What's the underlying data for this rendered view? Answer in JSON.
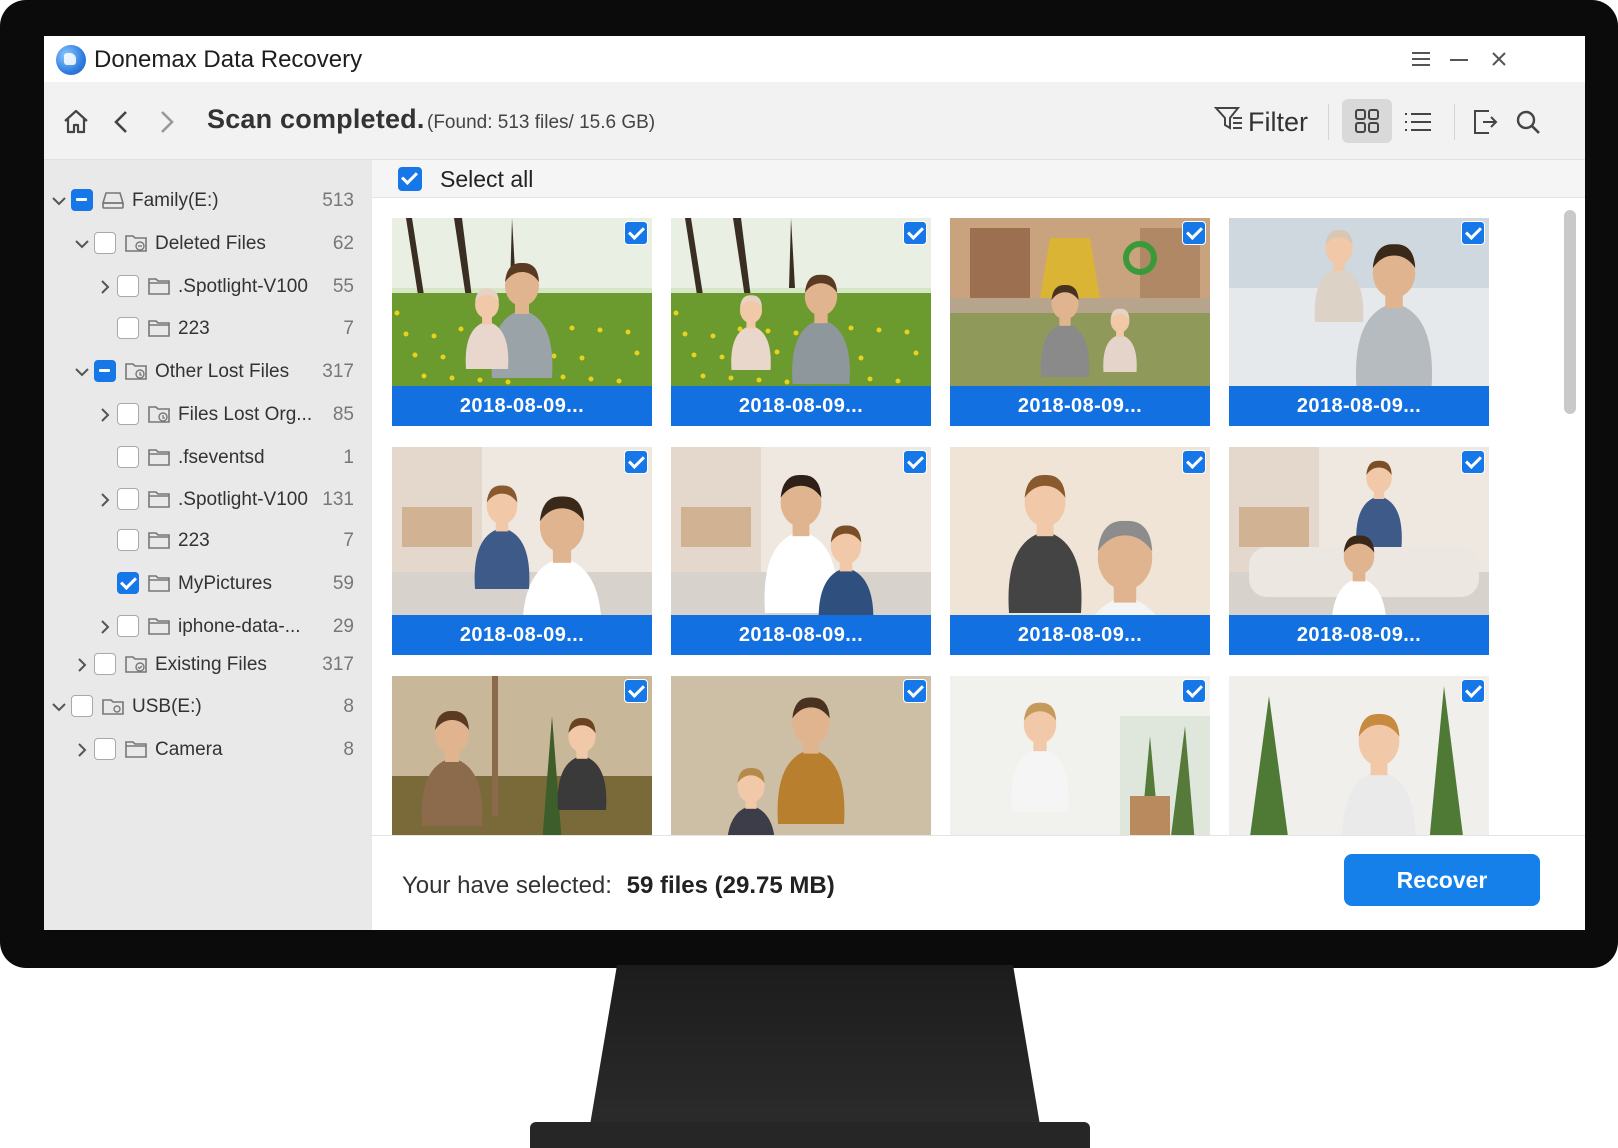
{
  "app": {
    "title": "Donemax Data Recovery"
  },
  "toolbar": {
    "scan_title": "Scan completed.",
    "scan_sub": "(Found: 513 files/ 15.6 GB)",
    "filter_label": "Filter"
  },
  "tree": [
    {
      "label": "Family(E:)",
      "count": "513",
      "level": 0,
      "expand": "open",
      "check": "partial",
      "icon": "drive-icon"
    },
    {
      "label": "Deleted Files",
      "count": "62",
      "level": 1,
      "expand": "open",
      "check": "none",
      "icon": "deleted-folder-icon"
    },
    {
      "label": ".Spotlight-V100",
      "count": "55",
      "level": 2,
      "expand": "closed",
      "check": "none",
      "icon": "folder-icon"
    },
    {
      "label": "223",
      "count": "7",
      "level": 2,
      "expand": "none",
      "check": "none",
      "icon": "folder-icon"
    },
    {
      "label": "Other Lost Files",
      "count": "317",
      "level": 1,
      "expand": "open",
      "check": "partial",
      "icon": "lost-folder-icon"
    },
    {
      "label": "Files Lost Org...",
      "count": "85",
      "level": 2,
      "expand": "closed",
      "check": "none",
      "icon": "lost-folder-icon"
    },
    {
      "label": ".fseventsd",
      "count": "1",
      "level": 2,
      "expand": "none",
      "check": "none",
      "icon": "folder-icon"
    },
    {
      "label": ".Spotlight-V100",
      "count": "131",
      "level": 2,
      "expand": "closed",
      "check": "none",
      "icon": "folder-icon"
    },
    {
      "label": "223",
      "count": "7",
      "level": 2,
      "expand": "none",
      "check": "none",
      "icon": "folder-icon"
    },
    {
      "label": "MyPictures",
      "count": "59",
      "level": 2,
      "expand": "none",
      "check": "checked",
      "icon": "folder-icon"
    },
    {
      "label": "iphone-data-...",
      "count": "29",
      "level": 2,
      "expand": "closed",
      "check": "none",
      "icon": "folder-icon"
    },
    {
      "label": "Existing Files",
      "count": "317",
      "level": 1,
      "expand": "closed",
      "check": "none",
      "icon": "existing-folder-icon"
    },
    {
      "label": "USB(E:)",
      "count": "8",
      "level": 0,
      "expand": "open",
      "check": "none",
      "icon": "usb-drive-icon"
    },
    {
      "label": "Camera",
      "count": "8",
      "level": 1,
      "expand": "closed",
      "check": "none",
      "icon": "folder-icon"
    }
  ],
  "content": {
    "select_all_label": "Select all",
    "select_all_checked": true,
    "tiles": [
      {
        "label": "2018-08-09...",
        "checked": true,
        "scene": "park-father-toddler"
      },
      {
        "label": "2018-08-09...",
        "checked": true,
        "scene": "park-toddler-walking"
      },
      {
        "label": "2018-08-09...",
        "checked": true,
        "scene": "playground"
      },
      {
        "label": "2018-08-09...",
        "checked": true,
        "scene": "father-lifting-baby"
      },
      {
        "label": "2018-08-09...",
        "checked": true,
        "scene": "boy-hugging-father"
      },
      {
        "label": "2018-08-09...",
        "checked": true,
        "scene": "father-son-sofa"
      },
      {
        "label": "2018-08-09...",
        "checked": true,
        "scene": "boy-embrace"
      },
      {
        "label": "2018-08-09...",
        "checked": true,
        "scene": "father-lifting-boy"
      },
      {
        "label": "",
        "checked": true,
        "scene": "planting-tree"
      },
      {
        "label": "",
        "checked": true,
        "scene": "father-son-autumn"
      },
      {
        "label": "",
        "checked": true,
        "scene": "boy-potting-plant"
      },
      {
        "label": "",
        "checked": true,
        "scene": "boy-with-plant"
      }
    ]
  },
  "footer": {
    "selected_prefix": "Your have selected:",
    "selected_value": "59 files (29.75 MB)",
    "recover_label": "Recover"
  },
  "colors": {
    "accent": "#1677e8",
    "tile_label": "#1370e0",
    "sidebar": "#e9e9e9"
  }
}
